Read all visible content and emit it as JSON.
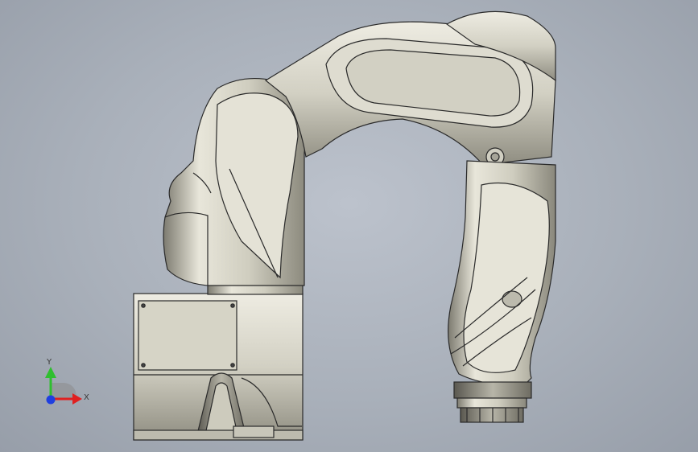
{
  "triad": {
    "y_label": "Y",
    "x_label": "X",
    "y_color": "#2fbf2f",
    "x_color": "#e02020",
    "z_color": "#1f3fe0"
  },
  "model": {
    "body_color": "#d8d6c8",
    "shadow_color": "#8e8c80",
    "edge_color": "#2a2a2a"
  }
}
